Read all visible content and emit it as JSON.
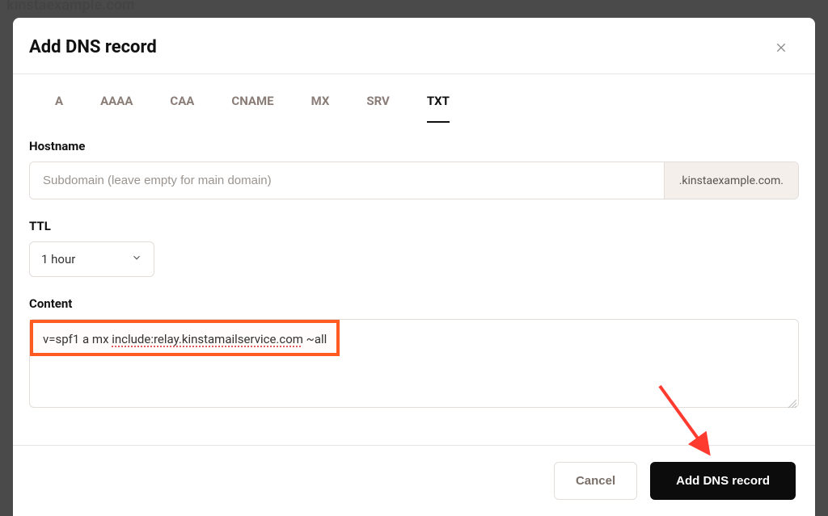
{
  "background": {
    "domain_title": "kinstaexample.com"
  },
  "modal": {
    "title": "Add DNS record",
    "tabs": [
      "A",
      "AAAA",
      "CAA",
      "CNAME",
      "MX",
      "SRV",
      "TXT"
    ],
    "active_tab": "TXT",
    "hostname": {
      "label": "Hostname",
      "placeholder": "Subdomain (leave empty for main domain)",
      "value": "",
      "suffix": ".kinstaexample.com."
    },
    "ttl": {
      "label": "TTL",
      "selected": "1 hour"
    },
    "content": {
      "label": "Content",
      "value_prefix": "v=spf1 a mx ",
      "value_underlined": "include:relay.kinstamailservice.com",
      "value_suffix": " ~all"
    },
    "footer": {
      "cancel": "Cancel",
      "submit": "Add DNS record"
    }
  },
  "annotation": {
    "highlight_color": "#ff5a1f",
    "arrow_color": "#ff3b30"
  }
}
